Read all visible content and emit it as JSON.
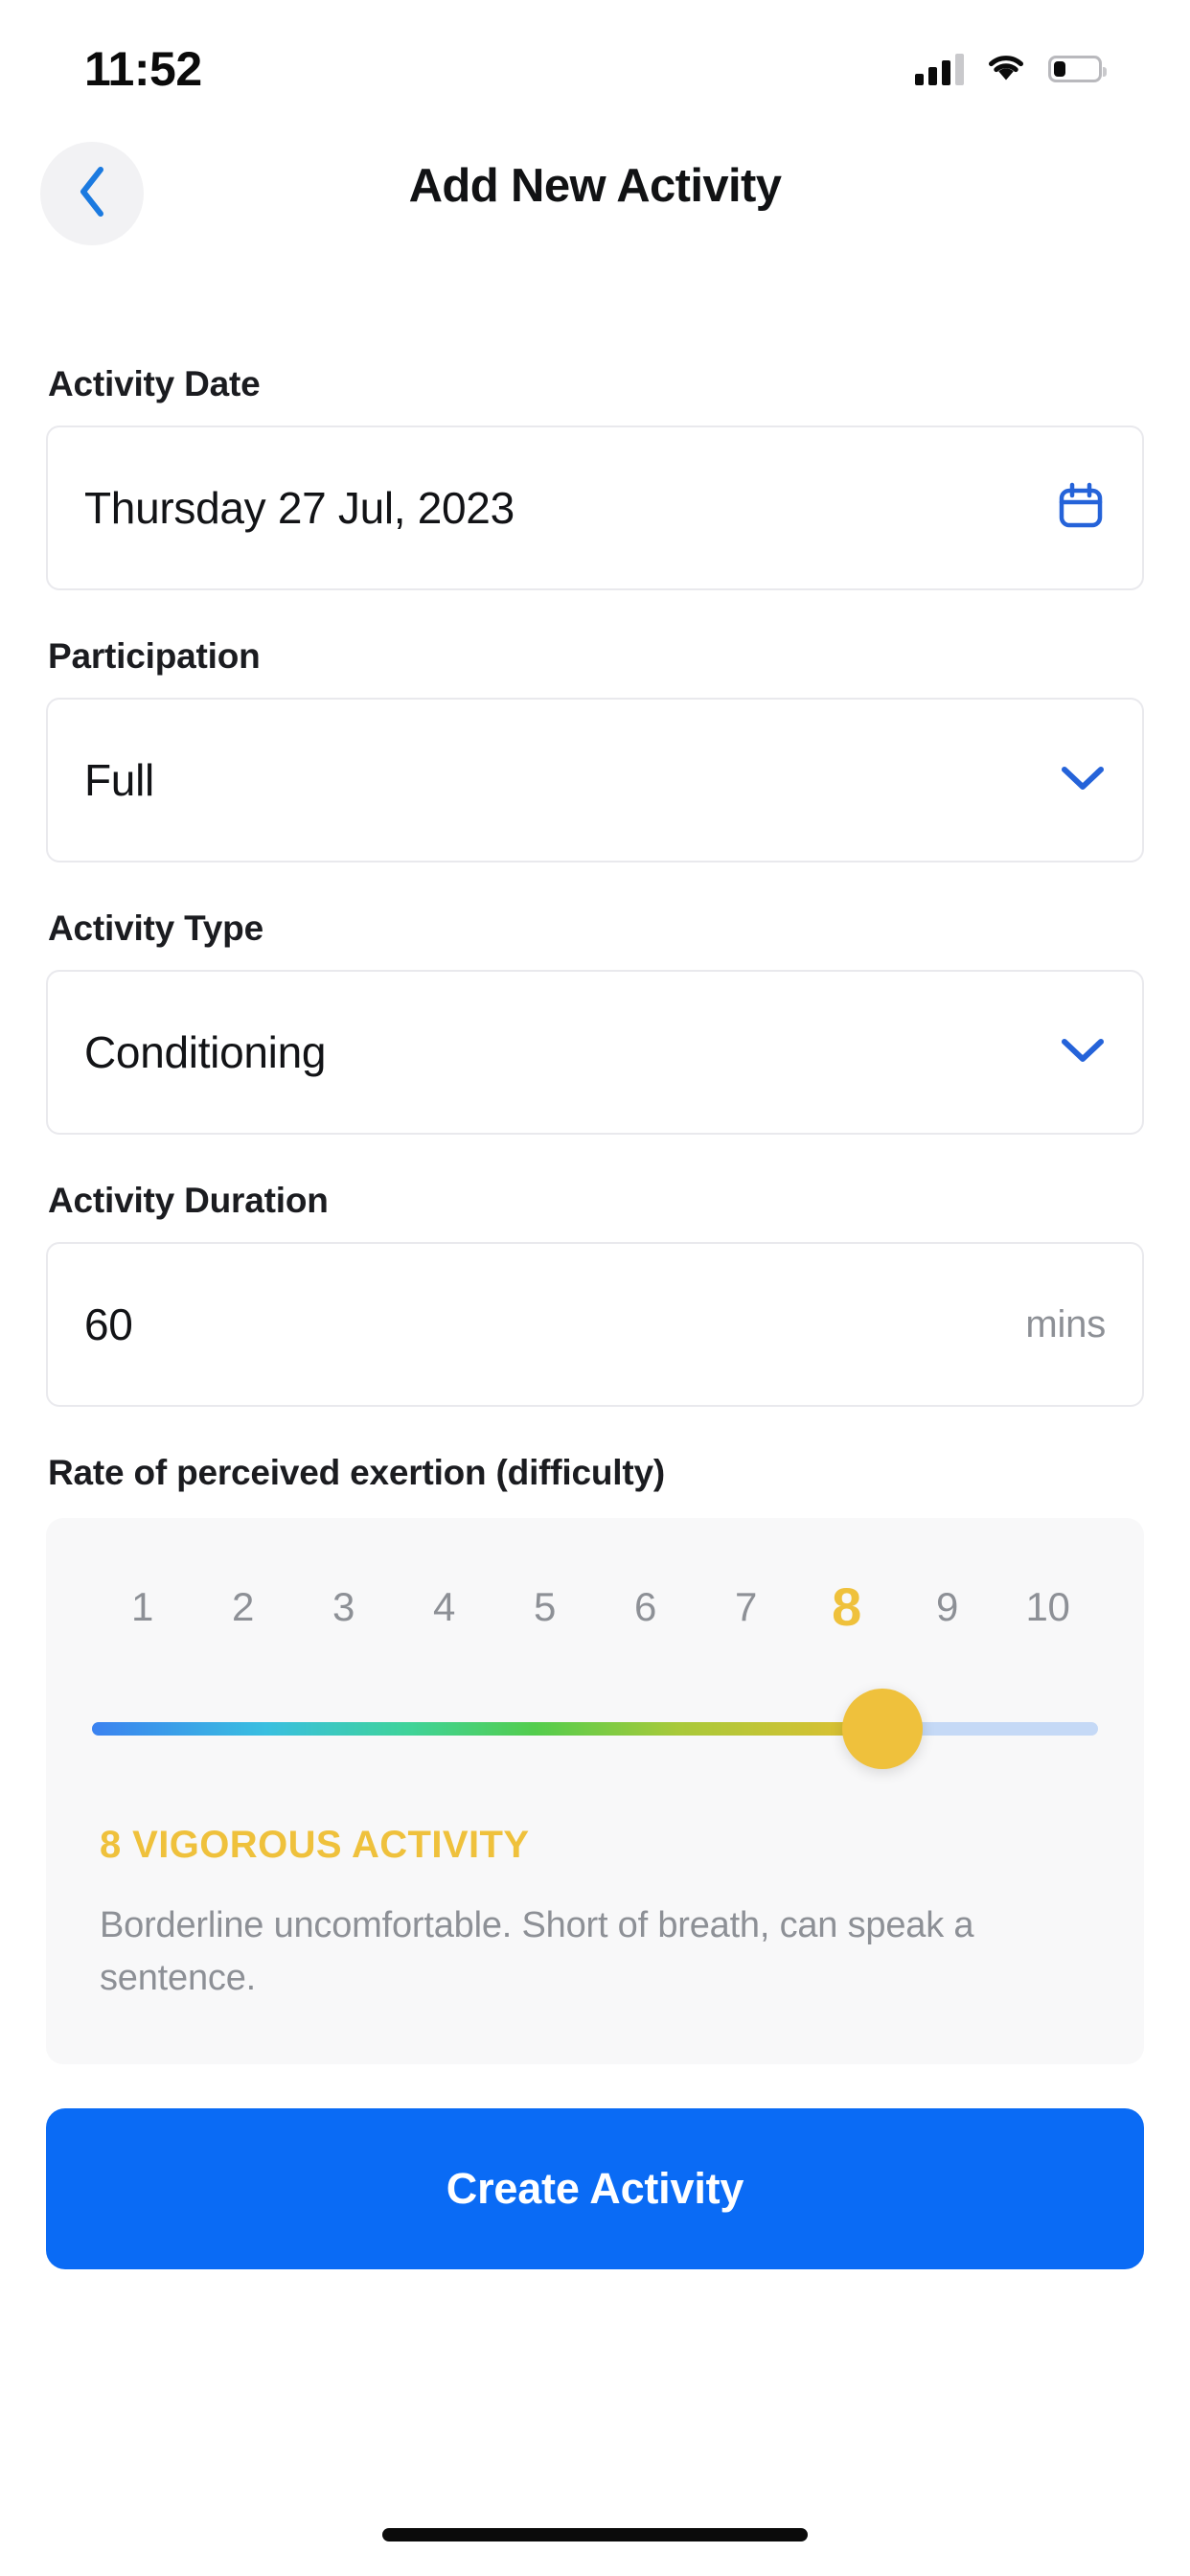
{
  "status_bar": {
    "time": "11:52",
    "signal_icon": "cellular-signal-icon",
    "wifi_icon": "wifi-icon",
    "battery_icon": "battery-low-icon"
  },
  "header": {
    "title": "Add New Activity",
    "back_icon": "chevron-left-icon"
  },
  "fields": {
    "activity_date": {
      "label": "Activity Date",
      "value": "Thursday 27 Jul, 2023",
      "icon": "calendar-icon"
    },
    "participation": {
      "label": "Participation",
      "value": "Full",
      "icon": "chevron-down-icon"
    },
    "activity_type": {
      "label": "Activity Type",
      "value": "Conditioning",
      "icon": "chevron-down-icon"
    },
    "activity_duration": {
      "label": "Activity Duration",
      "value": "60",
      "suffix": "mins"
    }
  },
  "rpe": {
    "heading": "Rate of perceived exertion (difficulty)",
    "scale": [
      "1",
      "2",
      "3",
      "4",
      "5",
      "6",
      "7",
      "8",
      "9",
      "10"
    ],
    "selected": "8",
    "title": "8 VIGOROUS ACTIVITY",
    "description": "Borderline uncomfortable. Short of breath, can speak a sentence.",
    "accent_color": "#EFC13C"
  },
  "cta": {
    "label": "Create Activity",
    "color": "#0a6bf5"
  },
  "colors": {
    "brand_blue": "#0a6bf5",
    "icon_blue": "#2563d9",
    "accent_gold": "#EFC13C",
    "muted_text": "#8d9096",
    "card_bg": "#f8f8f9"
  }
}
